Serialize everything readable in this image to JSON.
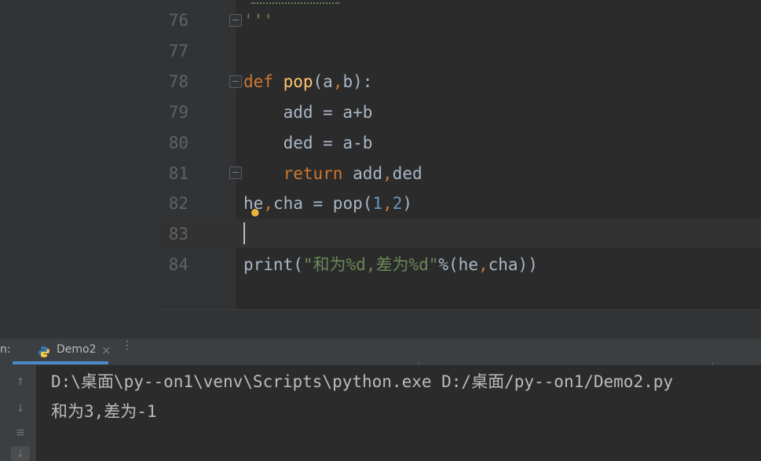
{
  "editor": {
    "lines": [
      {
        "no": "76",
        "tokens": [
          {
            "t": "'''",
            "c": "str"
          }
        ]
      },
      {
        "no": "77",
        "tokens": []
      },
      {
        "no": "78",
        "tokens": [
          {
            "t": "def",
            "c": "kw"
          },
          {
            "t": " ",
            "c": "op"
          },
          {
            "t": "pop",
            "c": "fn"
          },
          {
            "t": "(a",
            "c": "op"
          },
          {
            "t": ",",
            "c": "kw"
          },
          {
            "t": "b):",
            "c": "op"
          }
        ]
      },
      {
        "no": "79",
        "tokens": [
          {
            "t": "    add = a+b",
            "c": "op"
          }
        ]
      },
      {
        "no": "80",
        "tokens": [
          {
            "t": "    ded = a-b",
            "c": "op"
          }
        ]
      },
      {
        "no": "81",
        "tokens": [
          {
            "t": "    ",
            "c": "op"
          },
          {
            "t": "return",
            "c": "kw"
          },
          {
            "t": " add",
            "c": "op"
          },
          {
            "t": ",",
            "c": "kw"
          },
          {
            "t": "ded",
            "c": "op"
          }
        ]
      },
      {
        "no": "82",
        "tokens": [
          {
            "t": "he",
            "c": "op"
          },
          {
            "t": ",",
            "c": "kw"
          },
          {
            "t": "cha = pop(",
            "c": "op"
          },
          {
            "t": "1",
            "c": "num"
          },
          {
            "t": ",",
            "c": "kw"
          },
          {
            "t": "2",
            "c": "num"
          },
          {
            "t": ")",
            "c": "op"
          }
        ]
      },
      {
        "no": "83",
        "tokens": []
      },
      {
        "no": "84",
        "tokens": [
          {
            "t": "print",
            "c": "op"
          },
          {
            "t": "(",
            "c": "op"
          },
          {
            "t": "\"和为%d,差为%d\"",
            "c": "str"
          },
          {
            "t": "%(he",
            "c": "op"
          },
          {
            "t": ",",
            "c": "kw"
          },
          {
            "t": "cha))",
            "c": "op"
          }
        ]
      }
    ]
  },
  "run_panel": {
    "label": "n:",
    "tab_title": "Demo2",
    "tab_close": "×",
    "more": "⋮",
    "output": [
      "D:\\桌面\\py--on1\\venv\\Scripts\\python.exe D:/桌面/py--on1/Demo2.py",
      "和为3,差为-1"
    ]
  },
  "icons": {
    "up": "arrow-up-icon",
    "down": "arrow-down-icon",
    "wrap": "soft-wrap-icon",
    "scroll_end": "scroll-to-end-icon",
    "python": "python-icon",
    "bulb": "lightbulb-icon"
  }
}
